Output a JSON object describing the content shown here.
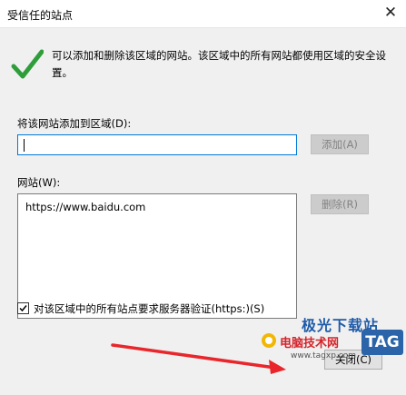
{
  "window": {
    "title": "受信任的站点",
    "close_glyph": "✕"
  },
  "info": {
    "text": "可以添加和删除该区域的网站。该区域中的所有网站都使用区域的安全设置。"
  },
  "add_section": {
    "label": "将该网站添加到区域(D):",
    "input_value": "",
    "add_button": "添加(A)"
  },
  "sites_section": {
    "label": "网站(W):",
    "items": [
      "https://www.baidu.com"
    ],
    "remove_button": "删除(R)"
  },
  "https_check": {
    "checked": true,
    "label": "对该区域中的所有站点要求服务器验证(https:)(S)"
  },
  "footer": {
    "close_button": "关闭(C)"
  },
  "watermark": {
    "line1": "极光下载站",
    "line2": "电脑技术网",
    "url": "www.tagxp.com",
    "tag": "TAG"
  },
  "colors": {
    "accent": "#0078d7",
    "check_green": "#2e9e3a",
    "arrow_red": "#e8262b"
  }
}
